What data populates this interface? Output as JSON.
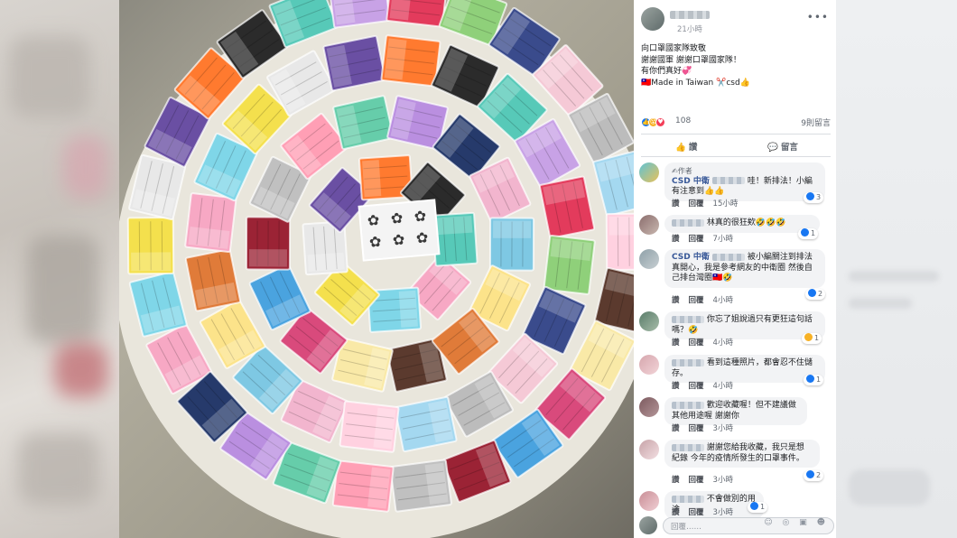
{
  "post": {
    "time": "21小時",
    "more": "•••",
    "text_lines": [
      "向口罩國家隊致敬",
      "謝謝國軍 謝謝口罩國家隊！",
      "有你們真好💞",
      "🇹🇼Made in Taiwan ✂️csd👍"
    ],
    "reaction_count": "108",
    "share_count": "9則留言",
    "actions": {
      "like": "讚",
      "comment": "留言"
    }
  },
  "comments": [
    {
      "badge": "✍作者",
      "name": "CSD 中衛",
      "text": "哇！新排法！小編有注意到👍👍",
      "reaction_count": "3",
      "reaction_type": "like",
      "time": "15小時",
      "like_label": "讚",
      "reply_label": "回覆"
    },
    {
      "name": "",
      "text": "林真的很狂欸🤣🤣🤣",
      "reaction_count": "1",
      "reaction_type": "like",
      "time": "7小時",
      "like_label": "讚",
      "reply_label": "回覆"
    },
    {
      "name": "CSD 中衛",
      "text": "被小編關注到排法真開心，我是參考網友的中衛圈 然後自己排台灣圈🇹🇼🤣",
      "reaction_count": "2",
      "reaction_type": "like",
      "time": "4小時",
      "like_label": "讚",
      "reply_label": "回覆"
    },
    {
      "name": "",
      "text": "你忘了姐說過只有更狂這句話嗎？🤣",
      "reaction_count": "1",
      "reaction_type": "laugh",
      "time": "4小時",
      "like_label": "讚",
      "reply_label": "回覆"
    },
    {
      "name": "",
      "text": "看到這種照片，都會忍不住儲存。",
      "reaction_count": "1",
      "reaction_type": "like",
      "time": "4小時",
      "like_label": "讚",
      "reply_label": "回覆"
    },
    {
      "name": "",
      "text": "歡迎收藏喔！但不建議做其他用途喔 謝謝你",
      "reaction_count": "",
      "reaction_type": "",
      "time": "3小時",
      "like_label": "讚",
      "reply_label": "回覆"
    },
    {
      "name": "",
      "text": "謝謝您給我收藏，我只是想 紀錄 今年的疫情所發生的口罩事件。",
      "reaction_count": "2",
      "reaction_type": "like",
      "time": "3小時",
      "like_label": "讚",
      "reply_label": "回覆"
    },
    {
      "name": "",
      "text": "不會做別的用途",
      "reaction_count": "1",
      "reaction_type": "like",
      "time": "3小時",
      "like_label": "讚",
      "reply_label": "回覆"
    }
  ],
  "composer": {
    "placeholder": "回覆……",
    "icons": "☺ ◎ ▣ ☻"
  },
  "colors": {
    "link": "#385898",
    "like": "#1877f2",
    "bubble": "#f2f3f5"
  }
}
